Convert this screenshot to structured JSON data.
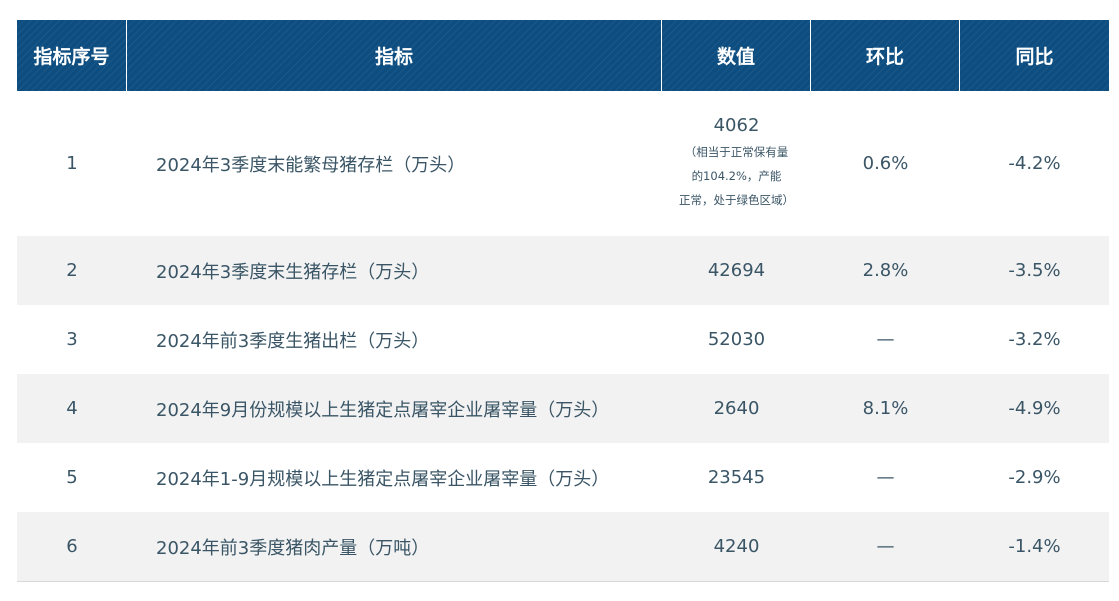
{
  "header": {
    "index": "指标序号",
    "indicator": "指标",
    "value": "数值",
    "mom": "环比",
    "yoy": "同比"
  },
  "rows": [
    {
      "index": "1",
      "indicator": "2024年3季度末能繁母猪存栏（万头）",
      "value": "4062",
      "value_note": [
        "（相当于正常保有量",
        "的104.2%，产能",
        "正常，处于绿色区域）"
      ],
      "mom": "0.6%",
      "yoy": "-4.2%"
    },
    {
      "index": "2",
      "indicator": "2024年3季度末生猪存栏（万头）",
      "value": "42694",
      "mom": "2.8%",
      "yoy": "-3.5%"
    },
    {
      "index": "3",
      "indicator": "2024年前3季度生猪出栏（万头）",
      "value": "52030",
      "mom": "—",
      "yoy": "-3.2%"
    },
    {
      "index": "4",
      "indicator": "2024年9月份规模以上生猪定点屠宰企业屠宰量（万头）",
      "value": "2640",
      "mom": "8.1%",
      "yoy": "-4.9%"
    },
    {
      "index": "5",
      "indicator": "2024年1-9月规模以上生猪定点屠宰企业屠宰量（万头）",
      "value": "23545",
      "mom": "—",
      "yoy": "-2.9%"
    },
    {
      "index": "6",
      "indicator": "2024年前3季度猪肉产量（万吨）",
      "value": "4240",
      "mom": "—",
      "yoy": "-1.4%"
    }
  ],
  "colors": {
    "header_bg": "#0d4d80",
    "header_text": "#ffffff",
    "body_text": "#3a5566",
    "alt_row_bg": "#f2f2f2"
  }
}
